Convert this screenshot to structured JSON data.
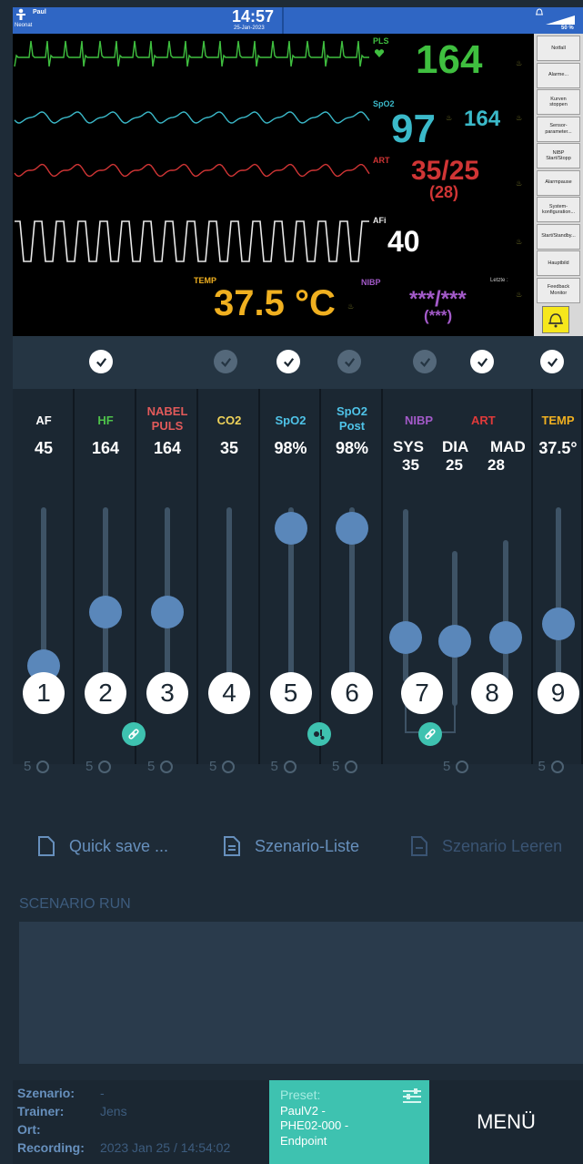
{
  "status": {
    "patient_name": "Paul",
    "patient_type": "Neonat",
    "time": "14:57",
    "date": "25-Jan-2023",
    "battery": "50 %"
  },
  "monitor": {
    "pls_label": "PLS",
    "hr_value": "164",
    "spo2_label": "SpO2",
    "spo2_value": "97",
    "spo2_pulse": "164",
    "art_label": "ART",
    "art_value": "35/25",
    "art_mean": "(28)",
    "afi_label": "AFi",
    "afi_value": "40",
    "temp_label": "TEMP",
    "temp_value": "37.5 °C",
    "nibp_label": "NIBP",
    "nibp_last_label": "Letzte :",
    "nibp_value": "***/***",
    "nibp_mean": "(***)"
  },
  "side_buttons": [
    "Notfall",
    "Alarme...",
    "Kurven\nstoppen",
    "Sensor-\nparameter...",
    "NIBP\nStart/Stopp",
    "Alarmpause",
    "System-\nkonfiguration...",
    "Start/Standby...",
    "Hauptbild",
    "Feedback\nMonitor"
  ],
  "vitals": [
    {
      "label": "AF",
      "value": "45",
      "number": "1",
      "timer": "5",
      "level": 0.32,
      "color": "#ffffff"
    },
    {
      "label": "HF",
      "value": "164",
      "number": "2",
      "timer": "5",
      "level": 0.58,
      "color": "#4ec24a"
    },
    {
      "label": "NABEL\nPULS",
      "value": "164",
      "number": "3",
      "timer": "5",
      "level": 0.58,
      "color": "#e25a5a"
    },
    {
      "label": "CO2",
      "value": "35",
      "number": "4",
      "timer": "5",
      "level": 0.18,
      "color": "#f0d35a"
    },
    {
      "label": "SpO2",
      "value": "98%",
      "number": "5",
      "timer": "5",
      "level": 0.98,
      "color": "#4fc3e8"
    },
    {
      "label": "SpO2\nPost",
      "value": "98%",
      "number": "6",
      "timer": "5",
      "level": 0.98,
      "color": "#4fc3e8"
    },
    {
      "label": "TEMP",
      "value": "37.5°",
      "number": "9",
      "timer": "5",
      "level": 0.52,
      "color": "#f0b020"
    }
  ],
  "nibp_group": {
    "nibp_label": "NIBP",
    "art_label": "ART",
    "number": "7",
    "number2": "8",
    "timer": "5",
    "sys_label": "SYS",
    "sys_value": "35",
    "dia_label": "DIA",
    "dia_value": "25",
    "mad_label": "MAD",
    "mad_value": "28"
  },
  "actions": {
    "quick_save": "Quick save ...",
    "scenario_list": "Szenario-Liste",
    "scenario_clear": "Szenario Leeren"
  },
  "scenario_run_title": "SCENARIO RUN",
  "info": {
    "szenario_label": "Szenario:",
    "szenario_value": "-",
    "trainer_label": "Trainer:",
    "trainer_value": "Jens",
    "ort_label": "Ort:",
    "ort_value": "",
    "recording_label": "Recording:",
    "recording_value": "2023 Jan 25 / 14:54:02"
  },
  "preset": {
    "label": "Preset:",
    "value": "PaulV2 -\nPHE02-000 -\nEndpoint"
  },
  "menu_label": "MENÜ",
  "colors": {
    "accent": "#3ec2b0",
    "knob": "#5a87ba",
    "background": "#1e2b37"
  }
}
